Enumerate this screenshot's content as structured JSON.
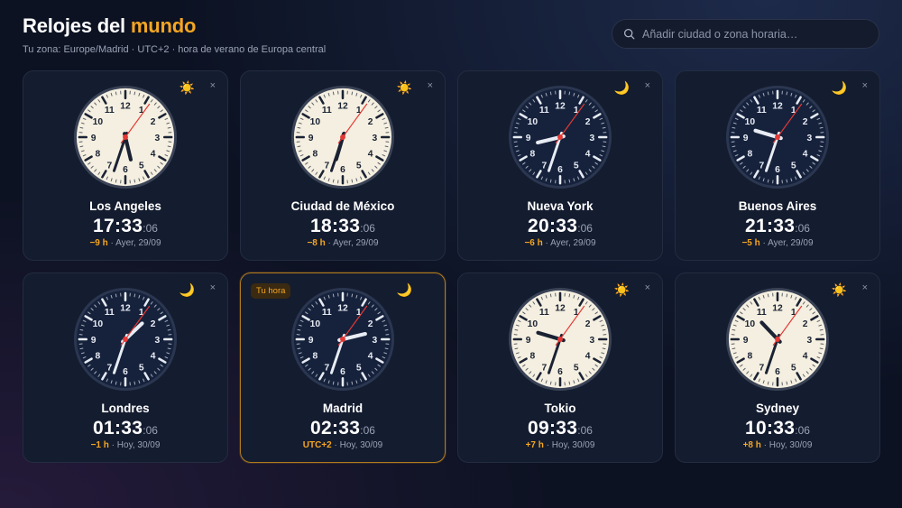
{
  "header": {
    "title_main": "Relojes del",
    "title_accent": "mundo",
    "subtitle": "Tu zona: Europe/Madrid · UTC+2 · hora de verano de Europa central"
  },
  "search": {
    "placeholder": "Añadir ciudad o zona horaria…",
    "icon": "search-icon"
  },
  "colors": {
    "accent": "#f5a623",
    "second_hand": "#e53935",
    "day_face": "#f4efe0",
    "night_face": "#16223c"
  },
  "clocks": [
    {
      "city": "Los Angeles",
      "hhmm": "17:33",
      "sec": ":06",
      "offset": "−9 h",
      "day": "Ayer, 29/09",
      "daynight": "☀️",
      "mode": "day",
      "hours": 17,
      "minutes": 33,
      "seconds": 6,
      "current": false,
      "close": "×"
    },
    {
      "city": "Ciudad de México",
      "hhmm": "18:33",
      "sec": ":06",
      "offset": "−8 h",
      "day": "Ayer, 29/09",
      "daynight": "☀️",
      "mode": "day",
      "hours": 18,
      "minutes": 33,
      "seconds": 6,
      "current": false,
      "close": "×"
    },
    {
      "city": "Nueva York",
      "hhmm": "20:33",
      "sec": ":06",
      "offset": "−6 h",
      "day": "Ayer, 29/09",
      "daynight": "🌙",
      "mode": "night",
      "hours": 20,
      "minutes": 33,
      "seconds": 6,
      "current": false,
      "close": "×"
    },
    {
      "city": "Buenos Aires",
      "hhmm": "21:33",
      "sec": ":06",
      "offset": "−5 h",
      "day": "Ayer, 29/09",
      "daynight": "🌙",
      "mode": "night",
      "hours": 21,
      "minutes": 33,
      "seconds": 6,
      "current": false,
      "close": "×"
    },
    {
      "city": "Londres",
      "hhmm": "01:33",
      "sec": ":06",
      "offset": "−1 h",
      "day": "Hoy, 30/09",
      "daynight": "🌙",
      "mode": "night",
      "hours": 1,
      "minutes": 33,
      "seconds": 6,
      "current": false,
      "close": "×"
    },
    {
      "city": "Madrid",
      "hhmm": "02:33",
      "sec": ":06",
      "offset": "UTC+2",
      "day": "Hoy, 30/09",
      "daynight": "🌙",
      "mode": "night",
      "hours": 2,
      "minutes": 33,
      "seconds": 6,
      "current": true,
      "badge": "Tu hora"
    },
    {
      "city": "Tokio",
      "hhmm": "09:33",
      "sec": ":06",
      "offset": "+7 h",
      "day": "Hoy, 30/09",
      "daynight": "☀️",
      "mode": "day",
      "hours": 9,
      "minutes": 33,
      "seconds": 6,
      "current": false,
      "close": "×"
    },
    {
      "city": "Sydney",
      "hhmm": "10:33",
      "sec": ":06",
      "offset": "+8 h",
      "day": "Hoy, 30/09",
      "daynight": "☀️",
      "mode": "day",
      "hours": 10,
      "minutes": 33,
      "seconds": 6,
      "current": false,
      "close": "×"
    }
  ]
}
